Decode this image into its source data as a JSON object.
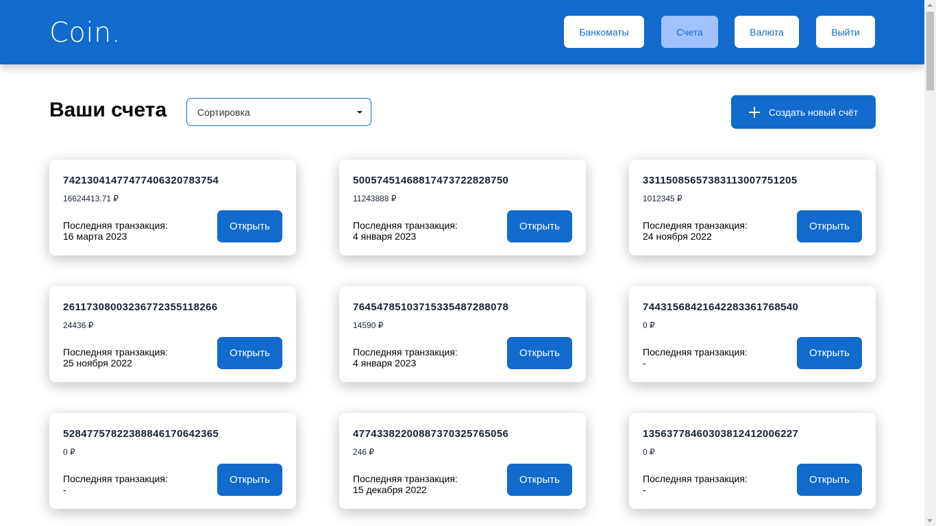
{
  "header": {
    "logo": "Coin.",
    "nav": [
      {
        "label": "Банкоматы",
        "active": false
      },
      {
        "label": "Счета",
        "active": true
      },
      {
        "label": "Валюта",
        "active": false
      },
      {
        "label": "Выйти",
        "active": false
      }
    ]
  },
  "toolbar": {
    "title": "Ваши счета",
    "sort_value": "Сортировка",
    "create_label": "Создать новый счёт"
  },
  "card_labels": {
    "last_transaction": "Последняя транзакция:",
    "open": "Открыть"
  },
  "accounts": [
    {
      "number": "74213041477477406320783754",
      "balance": "16624413.71 ₽",
      "last_tx": "16 марта 2023"
    },
    {
      "number": "50057451468817473722828750",
      "balance": "11243888 ₽",
      "last_tx": "4 января 2023"
    },
    {
      "number": "33115085657383113007751205",
      "balance": "1012345 ₽",
      "last_tx": "24 ноября 2022"
    },
    {
      "number": "26117308003236772355118266",
      "balance": "24436 ₽",
      "last_tx": "25 ноября 2022"
    },
    {
      "number": "76454785103715335487288078",
      "balance": "14590 ₽",
      "last_tx": "4 января 2023"
    },
    {
      "number": "74431568421642283361768540",
      "balance": "0 ₽",
      "last_tx": "-"
    },
    {
      "number": "52847757822388846170642365",
      "balance": "0 ₽",
      "last_tx": "-"
    },
    {
      "number": "47743382200887370325765056",
      "balance": "246 ₽",
      "last_tx": "15 декабря 2022"
    },
    {
      "number": "13563778460303812412006227",
      "balance": "0 ₽",
      "last_tx": "-"
    }
  ],
  "colors": {
    "primary": "#116ACC",
    "nav_active": "#A0C3FF",
    "text_dark": "#182233"
  }
}
